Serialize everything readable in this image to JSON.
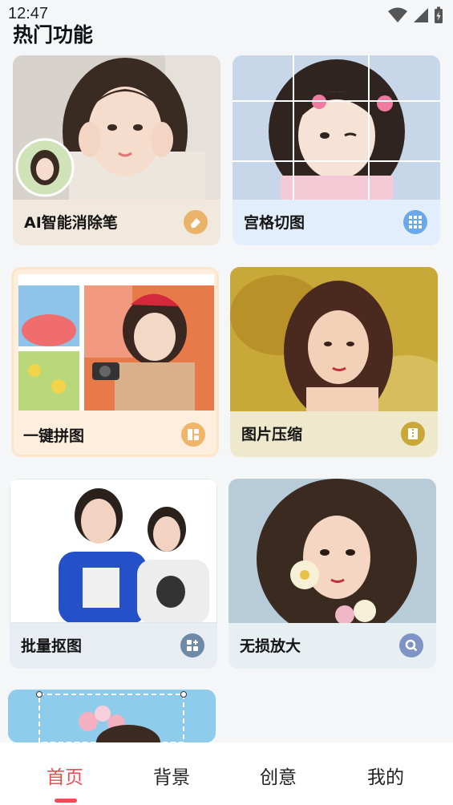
{
  "status": {
    "time": "12:47"
  },
  "section": {
    "title": "热门功能"
  },
  "cards": [
    {
      "label": "AI智能消除笔",
      "icon": "eraser-icon",
      "accent": "#eab36a"
    },
    {
      "label": "宫格切图",
      "icon": "grid-icon",
      "accent": "#6aa8ea"
    },
    {
      "label": "一键拼图",
      "icon": "collage-icon",
      "accent": "#f0b46a"
    },
    {
      "label": "图片压缩",
      "icon": "compress-icon",
      "accent": "#c9a838"
    },
    {
      "label": "批量抠图",
      "icon": "cutout-icon",
      "accent": "#6e8aa6"
    },
    {
      "label": "无损放大",
      "icon": "zoom-icon",
      "accent": "#7d94c4"
    }
  ],
  "nav": {
    "items": [
      {
        "label": "首页",
        "active": true
      },
      {
        "label": "背景",
        "active": false
      },
      {
        "label": "创意",
        "active": false
      },
      {
        "label": "我的",
        "active": false
      }
    ],
    "active_color": "#f04a55"
  }
}
